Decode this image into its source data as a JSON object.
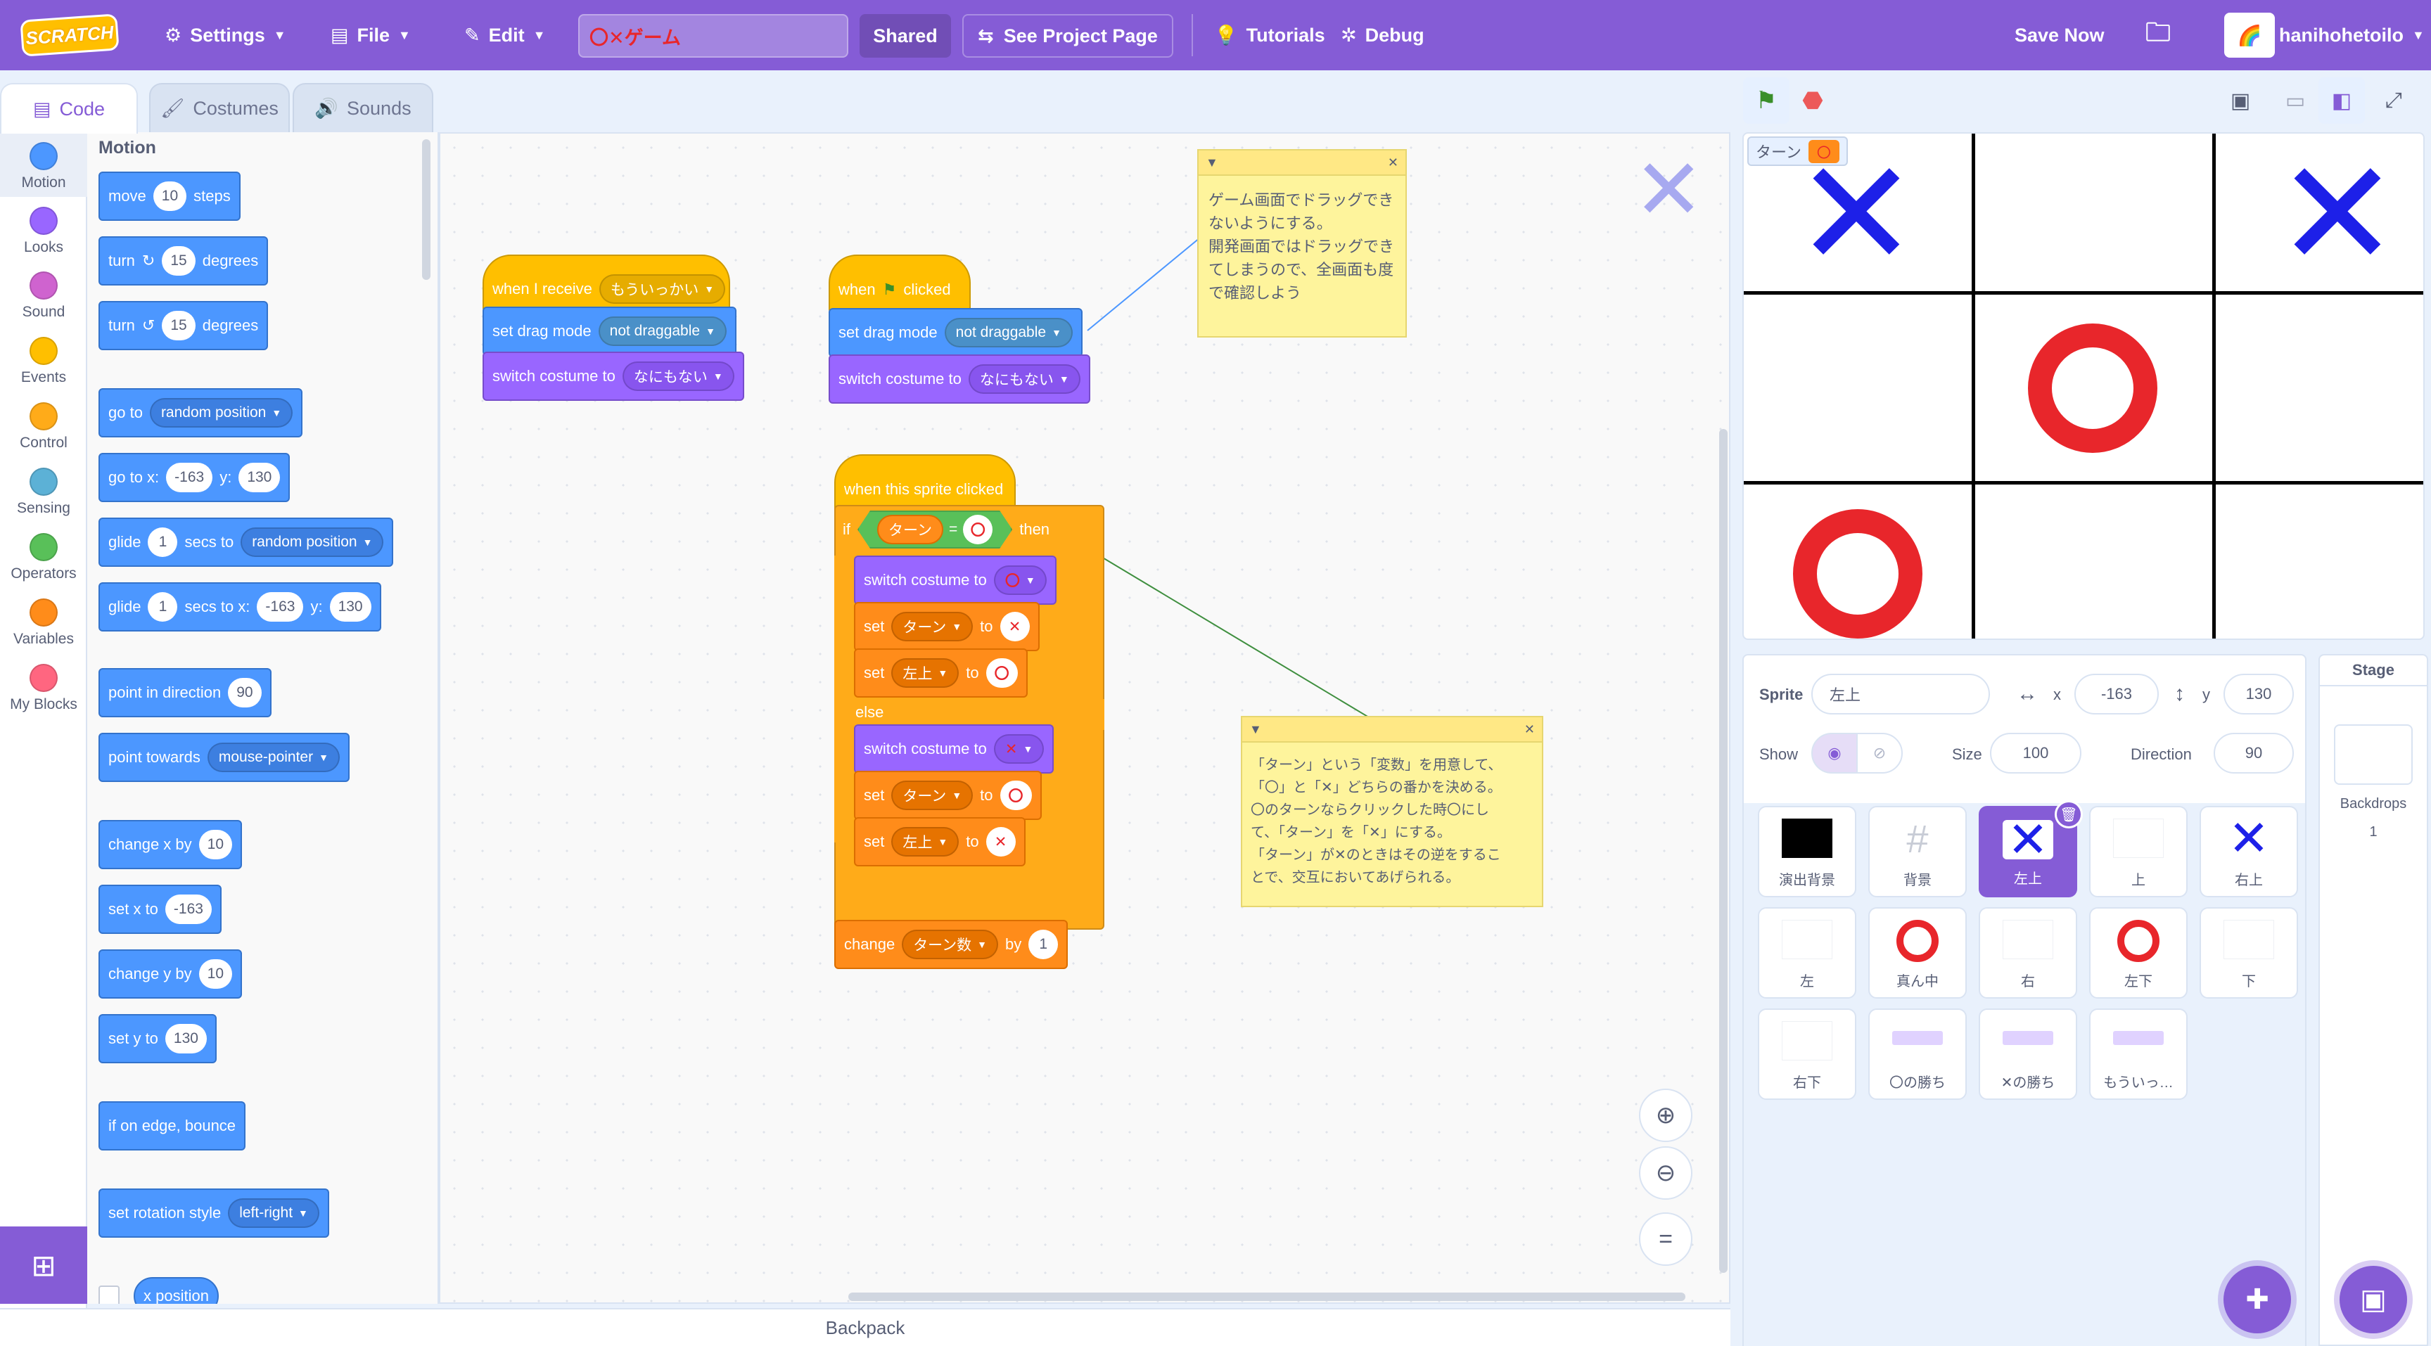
{
  "menubar": {
    "logo": "SCRATCH",
    "settings": "Settings",
    "file": "File",
    "edit": "Edit",
    "project_title": "〇✕ゲーム",
    "shared": "Shared",
    "see_project": "See Project Page",
    "tutorials": "Tutorials",
    "debug": "Debug",
    "save_now": "Save Now",
    "username": "hanihohetoilo"
  },
  "tabs": {
    "code": "Code",
    "costumes": "Costumes",
    "sounds": "Sounds"
  },
  "categories": [
    {
      "label": "Motion",
      "color": "#4c97ff"
    },
    {
      "label": "Looks",
      "color": "#9966ff"
    },
    {
      "label": "Sound",
      "color": "#cf63cf"
    },
    {
      "label": "Events",
      "color": "#ffbf00"
    },
    {
      "label": "Control",
      "color": "#ffab19"
    },
    {
      "label": "Sensing",
      "color": "#5cb1d6"
    },
    {
      "label": "Operators",
      "color": "#59c059"
    },
    {
      "label": "Variables",
      "color": "#ff8c1a"
    },
    {
      "label": "My Blocks",
      "color": "#ff6680"
    }
  ],
  "palette": {
    "title": "Motion",
    "move": {
      "a": "move",
      "n": "10",
      "b": "steps"
    },
    "turn_r": {
      "a": "turn",
      "n": "15",
      "b": "degrees"
    },
    "turn_l": {
      "a": "turn",
      "n": "15",
      "b": "degrees"
    },
    "goto": {
      "a": "go to",
      "d": "random position"
    },
    "gotoxy": {
      "a": "go to x:",
      "x": "-163",
      "b": "y:",
      "y": "130"
    },
    "glide1": {
      "a": "glide",
      "n": "1",
      "b": "secs to",
      "d": "random position"
    },
    "glide2": {
      "a": "glide",
      "n": "1",
      "b": "secs to x:",
      "x": "-163",
      "c": "y:",
      "y": "130"
    },
    "point": {
      "a": "point in direction",
      "n": "90"
    },
    "towards": {
      "a": "point towards",
      "d": "mouse-pointer"
    },
    "changex": {
      "a": "change x by",
      "n": "10"
    },
    "setx": {
      "a": "set x to",
      "n": "-163"
    },
    "changey": {
      "a": "change y by",
      "n": "10"
    },
    "sety": {
      "a": "set y to",
      "n": "130"
    },
    "bounce": "if on edge, bounce",
    "rotstyle": {
      "a": "set rotation style",
      "d": "left-right"
    },
    "xpos": "x position"
  },
  "scripts": {
    "s1": {
      "hat": "when I receive",
      "msg": "もういっかい",
      "drag": "set drag mode",
      "drag_v": "not draggable",
      "cost": "switch costume to",
      "cost_v": "なにもない"
    },
    "s2": {
      "hat_a": "when",
      "hat_b": "clicked",
      "drag": "set drag mode",
      "drag_v": "not draggable",
      "cost": "switch costume to",
      "cost_v": "なにもない"
    },
    "s3": {
      "hat": "when this sprite clicked",
      "if": "if",
      "var": "ターン",
      "eq": "=",
      "then": "then",
      "cost": "switch costume to",
      "set": "set",
      "to": "to",
      "var2": "左上",
      "else": "else",
      "change": "change",
      "var3": "ターン数",
      "by": "by",
      "n": "1"
    }
  },
  "notes": {
    "n1": [
      "ゲーム画面でドラッグでき",
      "ないようにする。",
      "開発画面ではドラッグでき",
      "てしまうので、全画面も度",
      "で確認しよう"
    ],
    "n2": [
      "「ターン」という「変数」を用意して、",
      "「〇」と「✕」どちらの番かを決める。",
      "〇のターンならクリックした時〇にし",
      "て、「ターン」を「✕」にする。",
      "「ターン」が✕のときはその逆をするこ",
      "とで、交互においてあげられる。"
    ]
  },
  "monitor": {
    "label": "ターン",
    "value": "〇"
  },
  "sprite_info": {
    "sprite_label": "Sprite",
    "sprite_name": "左上",
    "x_label": "x",
    "x": "-163",
    "y_label": "y",
    "y": "130",
    "show_label": "Show",
    "size_label": "Size",
    "size": "100",
    "direction_label": "Direction",
    "direction": "90"
  },
  "sprites": [
    {
      "name": "演出背景",
      "icon": "black"
    },
    {
      "name": "背景",
      "icon": "grid"
    },
    {
      "name": "左上",
      "icon": "x"
    },
    {
      "name": "上",
      "icon": "blank"
    },
    {
      "name": "右上",
      "icon": "x"
    },
    {
      "name": "左",
      "icon": "blank"
    },
    {
      "name": "真ん中",
      "icon": "o"
    },
    {
      "name": "右",
      "icon": "blank"
    },
    {
      "name": "左下",
      "icon": "o"
    },
    {
      "name": "下",
      "icon": "blank"
    },
    {
      "name": "右下",
      "icon": "blank"
    },
    {
      "name": "〇の勝ち",
      "icon": "label"
    },
    {
      "name": "✕の勝ち",
      "icon": "label"
    },
    {
      "name": "もういっ…",
      "icon": "label"
    }
  ],
  "stage_pane": {
    "title": "Stage",
    "backdrops": "Backdrops",
    "count": "1"
  },
  "backpack": "Backpack",
  "colors": {
    "accent": "#855cd6",
    "motion": "#4c97ff",
    "looks": "#9966ff",
    "events": "#ffbf00",
    "control": "#ffab19",
    "variables": "#ff8c1a",
    "operators": "#59c059",
    "x_mark": "#1d20e8",
    "o_mark": "#e8262b"
  }
}
